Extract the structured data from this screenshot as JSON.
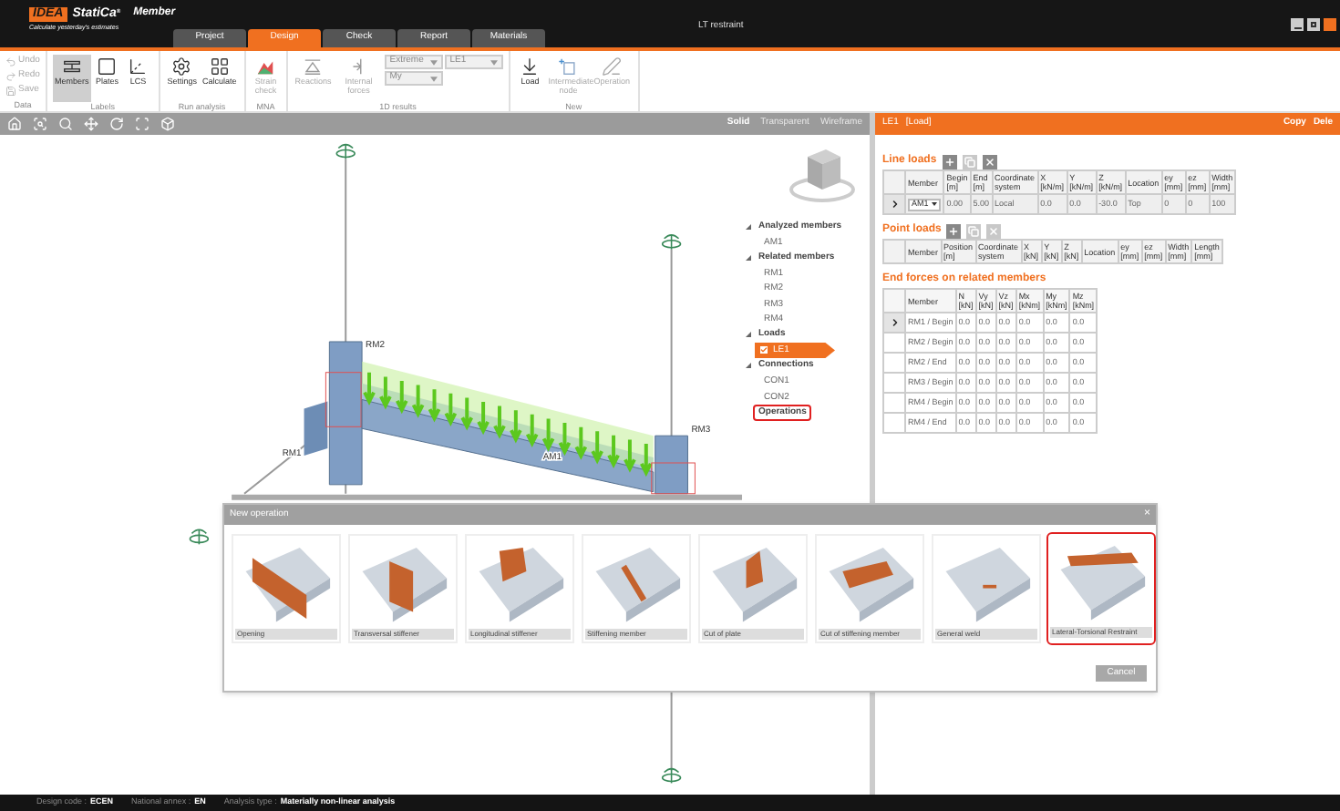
{
  "app": {
    "logo": "IDEA",
    "brand": "StatiCa",
    "brand_mark": "®",
    "module": "Member",
    "tagline": "Calculate yesterday's estimates",
    "document_title": "LT restraint"
  },
  "tabs": [
    {
      "label": "Project",
      "selected": false
    },
    {
      "label": "Design",
      "selected": true
    },
    {
      "label": "Check",
      "selected": false
    },
    {
      "label": "Report",
      "selected": false
    },
    {
      "label": "Materials",
      "selected": false
    }
  ],
  "ribbon": [
    {
      "label": "Data",
      "items": [
        {
          "kind": "small",
          "label": "Undo",
          "disabled": true
        },
        {
          "kind": "small",
          "label": "Redo",
          "disabled": true
        },
        {
          "kind": "small",
          "label": "Save",
          "disabled": true
        }
      ]
    },
    {
      "label": "Labels",
      "items": [
        {
          "kind": "large",
          "label": "Members",
          "selected": true,
          "disabled": false
        },
        {
          "kind": "large",
          "label": "Plates",
          "selected": false,
          "disabled": false
        },
        {
          "kind": "large",
          "label": "LCS",
          "selected": false,
          "disabled": false
        }
      ]
    },
    {
      "label": "Run analysis",
      "items": [
        {
          "kind": "large",
          "label": "Settings",
          "disabled": false
        },
        {
          "kind": "large",
          "label": "Calculate",
          "disabled": false
        }
      ]
    },
    {
      "label": "MNA",
      "items": [
        {
          "kind": "large",
          "label": "Strain check",
          "disabled": true
        }
      ]
    },
    {
      "label": "1D results",
      "items": [
        {
          "kind": "large",
          "label": "Reactions",
          "disabled": true
        },
        {
          "kind": "large",
          "label": "Internal forces",
          "disabled": true
        },
        {
          "kind": "select",
          "value": "Extreme",
          "disabled": true
        },
        {
          "kind": "select",
          "value": "LE1",
          "disabled": true
        },
        {
          "kind": "select",
          "value": "My",
          "disabled": true
        }
      ]
    },
    {
      "label": "New",
      "items": [
        {
          "kind": "large",
          "label": "Load",
          "disabled": false
        },
        {
          "kind": "large",
          "label": "Intermediate node",
          "disabled": true
        },
        {
          "kind": "large",
          "label": "Operation",
          "disabled": true
        }
      ]
    }
  ],
  "viewport": {
    "view_modes": [
      {
        "label": "Solid",
        "selected": true
      },
      {
        "label": "Transparent",
        "selected": false
      },
      {
        "label": "Wireframe",
        "selected": false
      }
    ],
    "member_labels": [
      "RM2",
      "RM3",
      "RM1",
      "AM1"
    ],
    "tree": [
      {
        "label": "Analyzed members",
        "expanded": true,
        "highlighted": false,
        "children": [
          {
            "label": "AM1",
            "selected": false
          }
        ]
      },
      {
        "label": "Related members",
        "expanded": true,
        "highlighted": false,
        "children": [
          {
            "label": "RM1",
            "selected": false
          },
          {
            "label": "RM2",
            "selected": false
          },
          {
            "label": "RM3",
            "selected": false
          },
          {
            "label": "RM4",
            "selected": false
          }
        ]
      },
      {
        "label": "Loads",
        "expanded": true,
        "highlighted": false,
        "children": [
          {
            "label": "LE1",
            "selected": true,
            "checked": true
          }
        ]
      },
      {
        "label": "Connections",
        "expanded": true,
        "highlighted": false,
        "children": [
          {
            "label": "CON1",
            "selected": false
          },
          {
            "label": "CON2",
            "selected": false
          }
        ]
      },
      {
        "label": "Operations",
        "highlighted": true
      }
    ]
  },
  "panel": {
    "title": "LE1",
    "subtitle": "[Load]",
    "actions": [
      "Copy",
      "Dele"
    ],
    "tables": [
      {
        "title": "Line loads",
        "kind": "editable",
        "toolbar": [
          {
            "disabled": false
          },
          {
            "disabled": true
          },
          {
            "disabled": false
          }
        ],
        "columns": [
          {
            "label": "Member"
          },
          {
            "label": "Begin",
            "unit": "[m]"
          },
          {
            "label": "End",
            "unit": "[m]"
          },
          {
            "label": "Coordinate",
            "unit": "system"
          },
          {
            "label": "X",
            "unit": "[kN/m]"
          },
          {
            "label": "Y",
            "unit": "[kN/m]"
          },
          {
            "label": "Z",
            "unit": "[kN/m]"
          },
          {
            "label": "Location"
          },
          {
            "label": "ey",
            "unit": "[mm]"
          },
          {
            "label": "ez",
            "unit": "[mm]"
          },
          {
            "label": "Width",
            "unit": "[mm]"
          }
        ],
        "rows": [
          {
            "selected": true,
            "cells": [
              "AM1",
              "0.00",
              "5.00",
              "Local",
              "0.0",
              "0.0",
              "-30.0",
              "Top",
              "0",
              "0",
              "100"
            ]
          }
        ]
      },
      {
        "title": "Point loads",
        "kind": "editable",
        "toolbar": [
          {
            "disabled": false
          },
          {
            "disabled": true
          },
          {
            "disabled": true
          }
        ],
        "columns": [
          {
            "label": "Member"
          },
          {
            "label": "Position",
            "unit": "[m]"
          },
          {
            "label": "Coordinate",
            "unit": "system"
          },
          {
            "label": "X",
            "unit": "[kN]"
          },
          {
            "label": "Y",
            "unit": "[kN]"
          },
          {
            "label": "Z",
            "unit": "[kN]"
          },
          {
            "label": "Location"
          },
          {
            "label": "ey",
            "unit": "[mm]"
          },
          {
            "label": "ez",
            "unit": "[mm]"
          },
          {
            "label": "Width",
            "unit": "[mm]"
          },
          {
            "label": "Length",
            "unit": "[mm]"
          }
        ]
      },
      {
        "title": "End forces on related members",
        "kind": "readonly",
        "columns": [
          {
            "label": "Member"
          },
          {
            "label": "N",
            "unit": "[kN]"
          },
          {
            "label": "Vy",
            "unit": "[kN]"
          },
          {
            "label": "Vz",
            "unit": "[kN]"
          },
          {
            "label": "Mx",
            "unit": "[kNm]"
          },
          {
            "label": "My",
            "unit": "[kNm]"
          },
          {
            "label": "Mz",
            "unit": "[kNm]"
          }
        ],
        "rows": [
          {
            "selected": true,
            "cells": [
              "RM1 / Begin",
              "0.0",
              "0.0",
              "0.0",
              "0.0",
              "0.0",
              "0.0"
            ]
          },
          {
            "selected": false,
            "cells": [
              "RM2 / Begin",
              "0.0",
              "0.0",
              "0.0",
              "0.0",
              "0.0",
              "0.0"
            ]
          },
          {
            "selected": false,
            "cells": [
              "RM2 / End",
              "0.0",
              "0.0",
              "0.0",
              "0.0",
              "0.0",
              "0.0"
            ]
          },
          {
            "selected": false,
            "cells": [
              "RM3 / Begin",
              "0.0",
              "0.0",
              "0.0",
              "0.0",
              "0.0",
              "0.0"
            ]
          },
          {
            "selected": false,
            "cells": [
              "RM4 / Begin",
              "0.0",
              "0.0",
              "0.0",
              "0.0",
              "0.0",
              "0.0"
            ]
          },
          {
            "selected": false,
            "cells": [
              "RM4 / End",
              "0.0",
              "0.0",
              "0.0",
              "0.0",
              "0.0",
              "0.0"
            ]
          }
        ]
      }
    ]
  },
  "dialog": {
    "title": "New operation",
    "close": "×",
    "items": [
      {
        "label": "Opening",
        "highlighted": false
      },
      {
        "label": "Transversal stiffener",
        "highlighted": false
      },
      {
        "label": "Longitudinal stiffener",
        "highlighted": false
      },
      {
        "label": "Stiffening member",
        "highlighted": false
      },
      {
        "label": "Cut of plate",
        "highlighted": false
      },
      {
        "label": "Cut of stiffening member",
        "highlighted": false
      },
      {
        "label": "General weld",
        "highlighted": false
      },
      {
        "label": "Lateral-Torsional Restraint",
        "highlighted": true
      }
    ],
    "cancel": "Cancel"
  },
  "status_bar": [
    {
      "label": "Design code :",
      "value": "ECEN"
    },
    {
      "label": "National annex :",
      "value": "EN"
    },
    {
      "label": "Analysis type :",
      "value": "Materially non-linear analysis"
    }
  ]
}
